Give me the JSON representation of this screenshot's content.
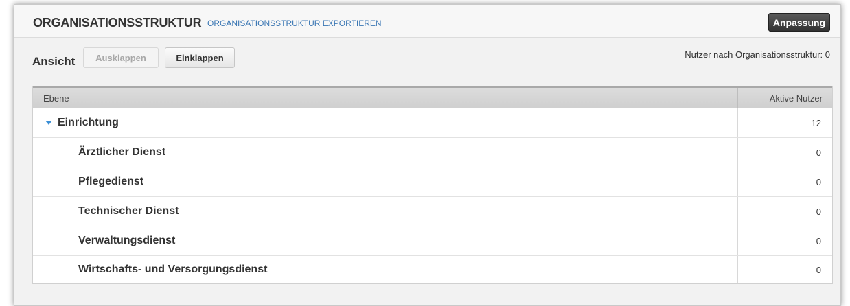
{
  "header": {
    "title": "ORGANISATIONSSTRUKTUR",
    "export_link": "ORGANISATIONSSTRUKTUR EXPORTIEREN",
    "customize_button": "Anpassung"
  },
  "toolbar": {
    "view_label": "Ansicht",
    "expand_button": "Ausklappen",
    "collapse_button": "Einklappen",
    "users_by_structure": "Nutzer nach Organisationsstruktur: 0"
  },
  "table": {
    "columns": {
      "level": "Ebene",
      "active_users": "Aktive Nutzer"
    },
    "root": {
      "label": "Einrichtung",
      "active_users": "12",
      "expanded": true
    },
    "children": [
      {
        "label": "Ärztlicher Dienst",
        "active_users": "0"
      },
      {
        "label": "Pflegedienst",
        "active_users": "0"
      },
      {
        "label": "Technischer Dienst",
        "active_users": "0"
      },
      {
        "label": "Verwaltungsdienst",
        "active_users": "0"
      },
      {
        "label": "Wirtschafts- und Versorgungsdienst",
        "active_users": "0"
      }
    ]
  },
  "colors": {
    "link": "#3b77b4",
    "caret": "#3b8fd6",
    "primary_button": "#333333"
  },
  "icons": {
    "expand_toggle": "caret-down-icon"
  }
}
